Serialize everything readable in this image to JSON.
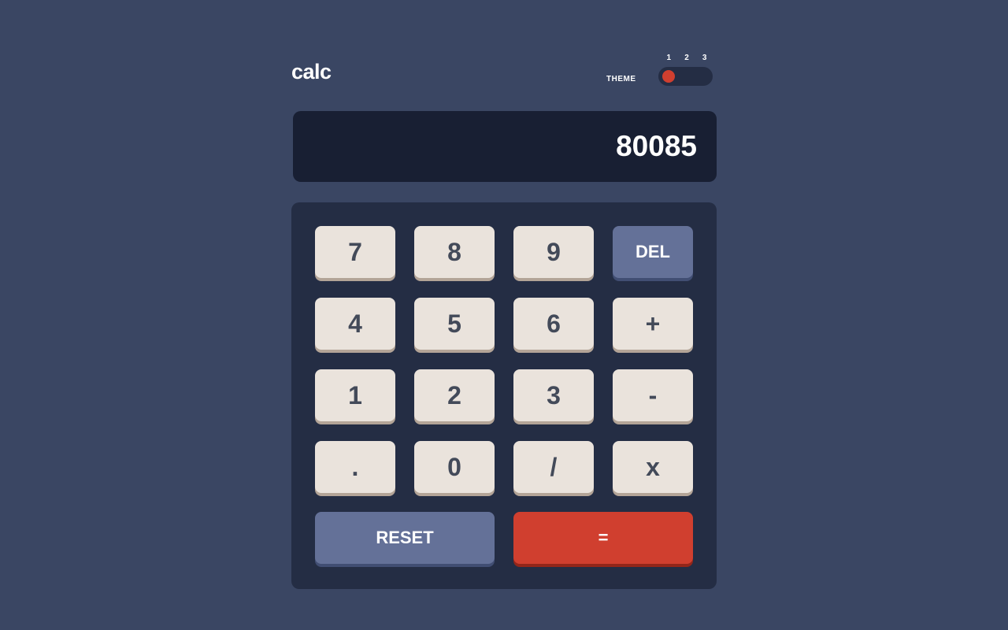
{
  "header": {
    "logo": "calc",
    "theme_label": "THEME",
    "theme_options": [
      "1",
      "2",
      "3"
    ],
    "theme_selected": 1
  },
  "display": {
    "value": "80085"
  },
  "keys": [
    "7",
    "8",
    "9",
    "DEL",
    "4",
    "5",
    "6",
    "+",
    "1",
    "2",
    "3",
    "-",
    ".",
    "0",
    "/",
    "x",
    "RESET",
    "="
  ],
  "colors": {
    "background": "#3a4663",
    "display": "#181f33",
    "keypad": "#242d44",
    "key": "#eae3dc",
    "del_reset": "#647198",
    "equals": "#d03f2f"
  }
}
